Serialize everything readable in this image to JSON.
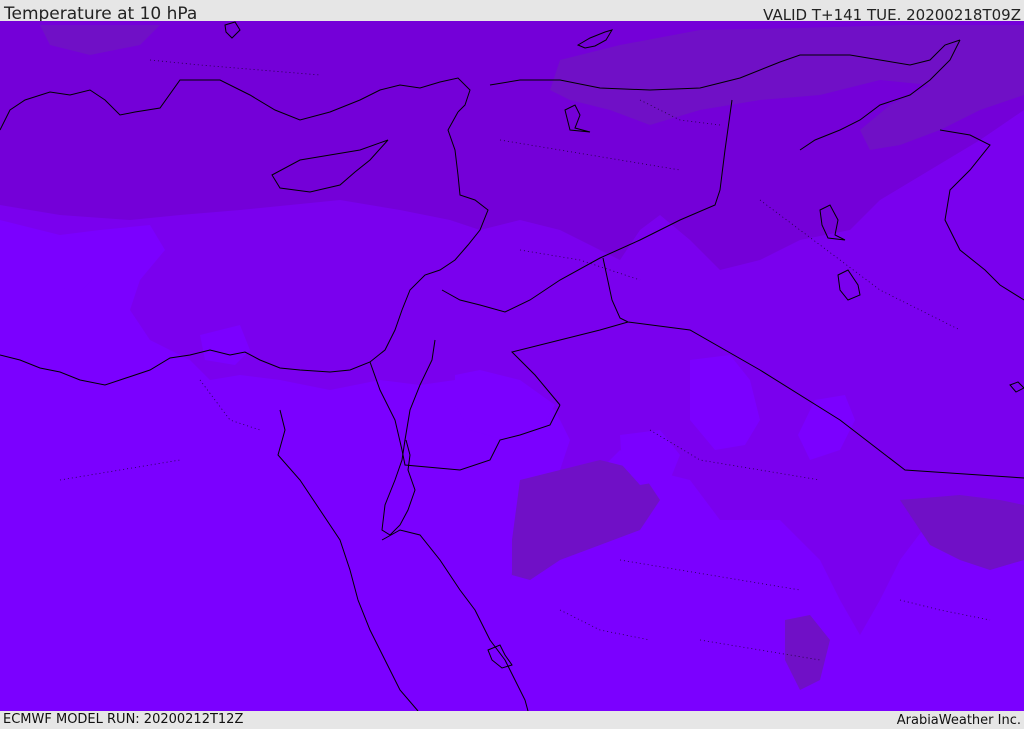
{
  "header": {
    "title": "Temperature at 10 hPa",
    "valid_time": "VALID T+141 TUE. 20200218T09Z"
  },
  "footer": {
    "model_run": "ECMWF MODEL RUN: 20200212T12Z",
    "credit": "ArabiaWeather Inc."
  },
  "map": {
    "field": "temperature",
    "level": "10 hPa",
    "colors": {
      "warm_band": "#7400d8",
      "mid_band": "#7a00ee",
      "cold_band": "#7b00ff",
      "warm_patch": "#7010c6",
      "coastline": "#000000"
    }
  }
}
